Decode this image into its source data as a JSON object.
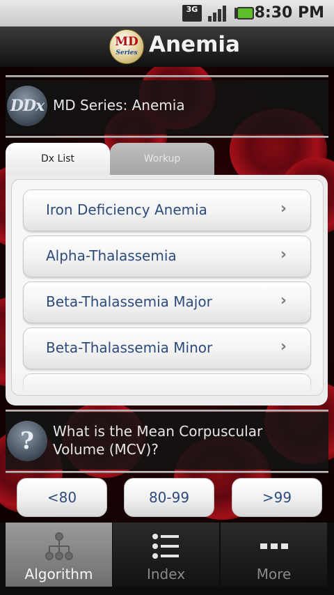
{
  "status_bar": {
    "network": "3G",
    "time": "8:30 PM"
  },
  "title_bar": {
    "logo_main": "MD",
    "logo_sub": "Series",
    "title": "Anemia"
  },
  "header": {
    "icon_text": "DDx",
    "text": "MD Series: Anemia"
  },
  "tabs": [
    {
      "label": "Dx List",
      "active": true
    },
    {
      "label": "Workup",
      "active": false
    }
  ],
  "list": {
    "items": [
      {
        "label": "Iron Deficiency Anemia"
      },
      {
        "label": "Alpha-Thalassemia"
      },
      {
        "label": "Beta-Thalassemia Major"
      },
      {
        "label": "Beta-Thalassemia Minor"
      }
    ],
    "chevron": "›"
  },
  "question": {
    "icon_text": "?",
    "text": "What is the Mean Corpuscular Volume (MCV)?"
  },
  "answers": [
    "<80",
    "80-99",
    ">99"
  ],
  "bottom_tabs": [
    {
      "label": "Algorithm",
      "icon": "algorithm-tree-icon",
      "active": true
    },
    {
      "label": "Index",
      "icon": "index-list-icon",
      "active": false
    },
    {
      "label": "More",
      "icon": "more-dots-icon",
      "active": false
    }
  ],
  "colors": {
    "accent_text": "#2c4b7c",
    "background": "#1a0306"
  }
}
